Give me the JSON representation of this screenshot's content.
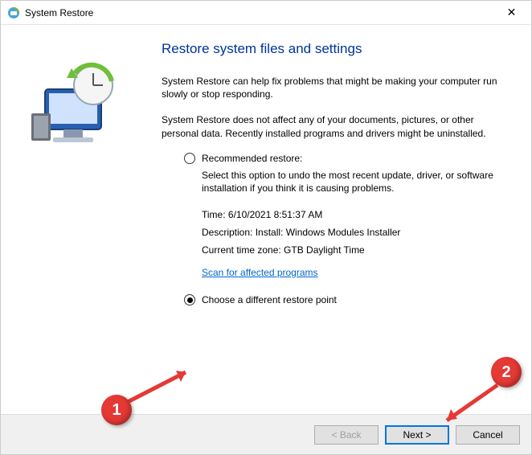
{
  "window": {
    "title": "System Restore",
    "close_glyph": "✕"
  },
  "heading": "Restore system files and settings",
  "intro1": "System Restore can help fix problems that might be making your computer run slowly or stop responding.",
  "intro2": "System Restore does not affect any of your documents, pictures, or other personal data. Recently installed programs and drivers might be uninstalled.",
  "options": {
    "recommended": {
      "label": "Recommended restore:",
      "desc": "Select this option to undo the most recent update, driver, or software installation if you think it is causing problems.",
      "time": "Time: 6/10/2021 8:51:37 AM",
      "description": "Description: Install: Windows Modules Installer",
      "timezone": "Current time zone: GTB Daylight Time",
      "scan_link": "Scan for affected programs",
      "selected": false
    },
    "different": {
      "label": "Choose a different restore point",
      "selected": true
    }
  },
  "buttons": {
    "back": "< Back",
    "next": "Next >",
    "cancel": "Cancel"
  },
  "annotations": {
    "badge1": "1",
    "badge2": "2"
  }
}
